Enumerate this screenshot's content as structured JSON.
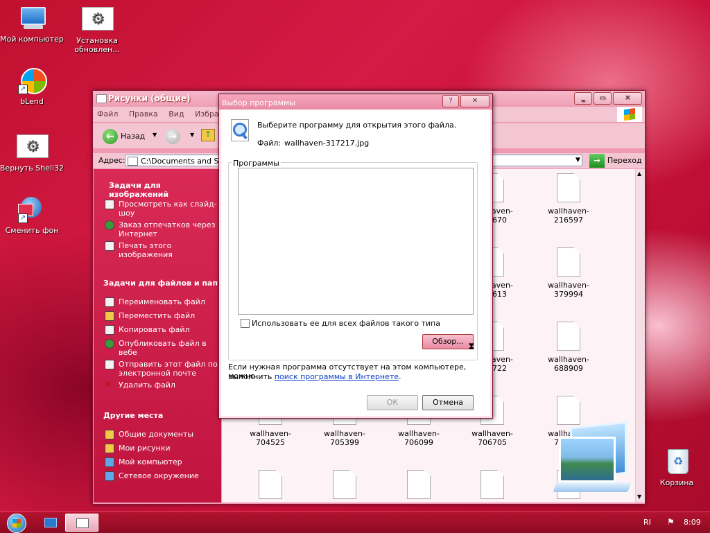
{
  "desktop": {
    "icons": [
      {
        "label": "Мой компьютер"
      },
      {
        "label": "Установка обновлен..."
      },
      {
        "label": "bLend"
      },
      {
        "label": "Вернуть Shell32"
      },
      {
        "label": "Сменить фон"
      },
      {
        "label": "Корзина"
      }
    ]
  },
  "explorer": {
    "title": "Рисунки (общие)",
    "menu": [
      "Файл",
      "Правка",
      "Вид",
      "Избра"
    ],
    "back_label": "Назад",
    "address_label": "Адрес:",
    "address_value": "C:\\Documents and Se",
    "go_label": "Переход",
    "sections": {
      "image_tasks": {
        "title": "Задачи для изображений",
        "items": [
          "Просмотреть как слайд-шоу",
          "Заказ отпечатков через Интернет",
          "Печать этого изображения"
        ]
      },
      "file_tasks": {
        "title": "Задачи для файлов и пап",
        "items": [
          "Переименовать файл",
          "Переместить файл",
          "Копировать файл",
          "Опубликовать файл в вебе",
          "Отправить этот файл по электронной почте",
          "Удалить файл"
        ]
      },
      "other_places": {
        "title": "Другие места",
        "items": [
          "Общие документы",
          "Мои рисунки",
          "Мой компьютер",
          "Сетевое окружение"
        ]
      }
    },
    "files": {
      "row1": [
        "wallhaven-157670",
        "wallhaven-216597"
      ],
      "row2": [
        "wallhaven-363613",
        "wallhaven-379994"
      ],
      "row3": [
        "wallhaven-664722",
        "wallhaven-688909"
      ],
      "row4": [
        "wallhaven-704525",
        "wallhaven-705399",
        "wallhaven-706099",
        "wallhaven-706705",
        "wallhaven-708553"
      ]
    }
  },
  "dialog": {
    "title": "Выбор программы",
    "help_label": "?",
    "close_label": "✕",
    "prompt": "Выберите программу для открытия этого файла.",
    "file_label": "Файл:",
    "file_name": "wallhaven-317217.jpg",
    "programs_label": "Программы",
    "always_use_label": "Использовать ее для всех файлов такого типа",
    "browse_label": "Обзор...",
    "footer_text_1": "Если нужная программа отсутствует на этом компьютере, можно",
    "footer_text_2": "выполнить",
    "footer_link": "поиск программы в Интернете",
    "footer_dot": ".",
    "ok_label": "ОК",
    "cancel_label": "Отмена"
  },
  "taskbar": {
    "lang": "RI",
    "clock": "8:09"
  }
}
